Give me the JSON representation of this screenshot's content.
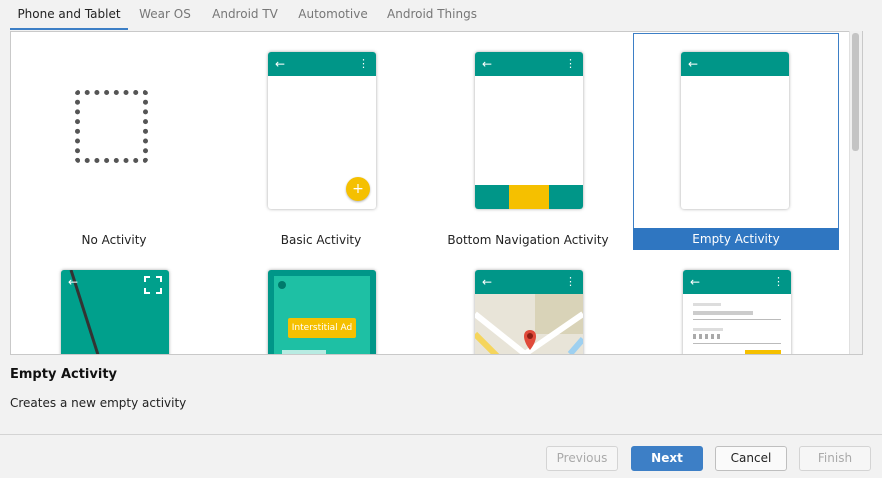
{
  "tabs": [
    {
      "label": "Phone and Tablet",
      "active": true
    },
    {
      "label": "Wear OS",
      "active": false
    },
    {
      "label": "Android TV",
      "active": false
    },
    {
      "label": "Automotive",
      "active": false
    },
    {
      "label": "Android Things",
      "active": false
    }
  ],
  "templates": [
    {
      "label": "No Activity",
      "icon": "dotted-square-icon",
      "selected": false
    },
    {
      "label": "Basic Activity",
      "icon": "basic-activity-preview-icon",
      "selected": false
    },
    {
      "label": "Bottom Navigation Activity",
      "icon": "bottom-navigation-preview-icon",
      "selected": false
    },
    {
      "label": "Empty Activity",
      "icon": "empty-activity-preview-icon",
      "selected": true
    },
    {
      "label": "",
      "icon": "fullscreen-activity-preview-icon",
      "selected": false
    },
    {
      "label": "",
      "icon": "interstitial-ad-preview-icon",
      "selected": false,
      "badge_text": "Interstitial Ad"
    },
    {
      "label": "",
      "icon": "maps-activity-preview-icon",
      "selected": false
    },
    {
      "label": "",
      "icon": "login-activity-preview-icon",
      "selected": false
    }
  ],
  "description": {
    "title": "Empty Activity",
    "text": "Creates a new empty activity"
  },
  "buttons": {
    "previous": "Previous",
    "next": "Next",
    "cancel": "Cancel",
    "finish": "Finish"
  },
  "colors": {
    "app_bar": "#009688",
    "accent": "#f5c000",
    "selection": "#2f76c1"
  }
}
